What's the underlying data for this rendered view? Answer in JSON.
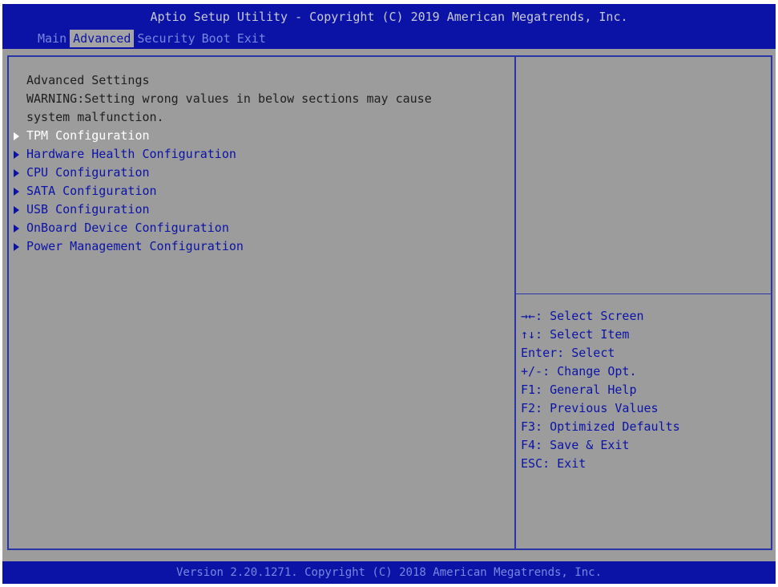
{
  "header": {
    "title": "Aptio Setup Utility - Copyright (C) 2019 American Megatrends, Inc.",
    "tabs": [
      {
        "label": "Main"
      },
      {
        "label": "Advanced"
      },
      {
        "label": "Security"
      },
      {
        "label": "Boot"
      },
      {
        "label": "Exit"
      }
    ],
    "active_tab": "Advanced"
  },
  "main": {
    "heading": "Advanced Settings",
    "warning_line1": "WARNING:Setting wrong values in below sections may cause",
    "warning_line2": "system malfunction.",
    "menu_items": [
      {
        "label": "TPM Configuration",
        "selected": true
      },
      {
        "label": "Hardware Health Configuration",
        "selected": false
      },
      {
        "label": "CPU Configuration",
        "selected": false
      },
      {
        "label": "SATA Configuration",
        "selected": false
      },
      {
        "label": "USB Configuration",
        "selected": false
      },
      {
        "label": "OnBoard Device Configuration",
        "selected": false
      },
      {
        "label": "Power Management Configuration",
        "selected": false
      }
    ]
  },
  "help": {
    "keys": [
      "→←: Select Screen",
      "↑↓: Select Item",
      "Enter: Select",
      "+/-: Change Opt.",
      "F1: General Help",
      "F2: Previous Values",
      "F3: Optimized Defaults",
      "F4: Save & Exit",
      "ESC: Exit"
    ]
  },
  "footer": {
    "text": "Version 2.20.1271. Copyright (C) 2018 American Megatrends, Inc."
  },
  "colors": {
    "header_bg": "#0b13a6",
    "panel_bg": "#9c9c9c",
    "menu_text": "#0b13a6",
    "selected_text": "#ffffff"
  }
}
